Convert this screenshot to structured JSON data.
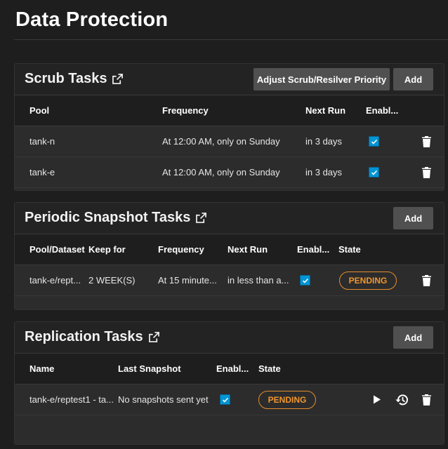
{
  "page": {
    "title": "Data Protection"
  },
  "scrub": {
    "title": "Scrub Tasks",
    "adjust_label": "Adjust Scrub/Resilver Priority",
    "add_label": "Add",
    "columns": [
      "Pool",
      "Frequency",
      "Next Run",
      "Enabl..."
    ],
    "rows": [
      {
        "pool": "tank-n",
        "frequency": "At 12:00 AM, only on Sunday",
        "next_run": "in 3 days",
        "enabled": true
      },
      {
        "pool": "tank-e",
        "frequency": "At 12:00 AM, only on Sunday",
        "next_run": "in 3 days",
        "enabled": true
      }
    ]
  },
  "snapshot": {
    "title": "Periodic Snapshot Tasks",
    "add_label": "Add",
    "columns": [
      "Pool/Dataset",
      "Keep for",
      "Frequency",
      "Next Run",
      "Enabl...",
      "State"
    ],
    "rows": [
      {
        "dataset": "tank-e/rept...",
        "keep_for": "2 WEEK(S)",
        "frequency": "At 15 minute...",
        "next_run": "in less than a...",
        "enabled": true,
        "state": "PENDING"
      }
    ]
  },
  "replication": {
    "title": "Replication Tasks",
    "add_label": "Add",
    "columns": [
      "Name",
      "Last Snapshot",
      "Enabl...",
      "State"
    ],
    "rows": [
      {
        "name": "tank-e/reptest1 - ta...",
        "last_snapshot": "No snapshots sent yet",
        "enabled": true,
        "state": "PENDING"
      }
    ]
  },
  "colors": {
    "accent_blue": "#0095d5",
    "pending_orange": "#e68d2e",
    "background": "#1e1e1e",
    "card": "#2c2c2c"
  },
  "icons": [
    "open-in-new-icon",
    "checkmark-icon",
    "delete-icon",
    "play-icon",
    "restore-icon"
  ]
}
